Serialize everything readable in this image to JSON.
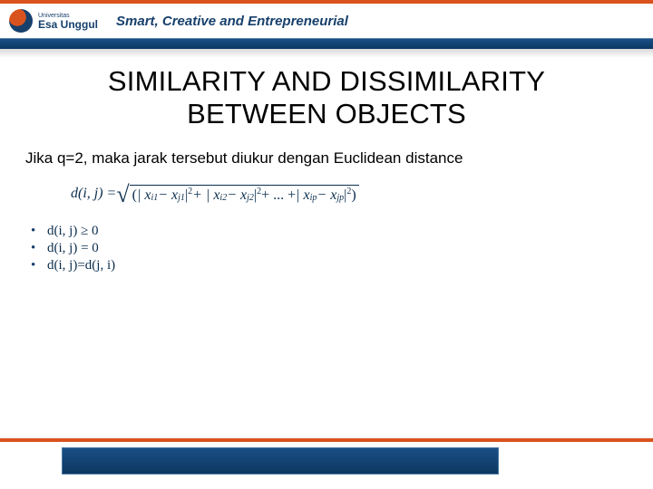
{
  "header": {
    "logo_small": "Universitas",
    "logo_name": "Esa Unggul",
    "tagline": "Smart, Creative and Entrepreneurial"
  },
  "slide": {
    "title_line1": "SIMILARITY AND DISSIMILARITY",
    "title_line2": "BETWEEN OBJECTS",
    "body": "Jika q=2, maka jarak tersebut diukur dengan Euclidean distance",
    "formula_lhs": "d(i, j) =",
    "formula_terms": {
      "t1a": "| x",
      "t1a_sub": "i1",
      "t1b": " − x",
      "t1b_sub": "j1",
      "t1_end": " |",
      "t2a": " + | x",
      "t2a_sub": "i2",
      "t2b": " − x",
      "t2b_sub": "j2",
      "t2_end": " |",
      "dots": " + ... + ",
      "tpa": "| x",
      "tpa_sub": "ip",
      "tpb": " − x",
      "tpb_sub": "jp",
      "tp_end": " |"
    },
    "sq": "2",
    "properties": {
      "p1": "d(i, j) ≥ 0",
      "p2": "d(i, j) = 0",
      "p3": "d(i, j)=d(j, i)"
    }
  }
}
